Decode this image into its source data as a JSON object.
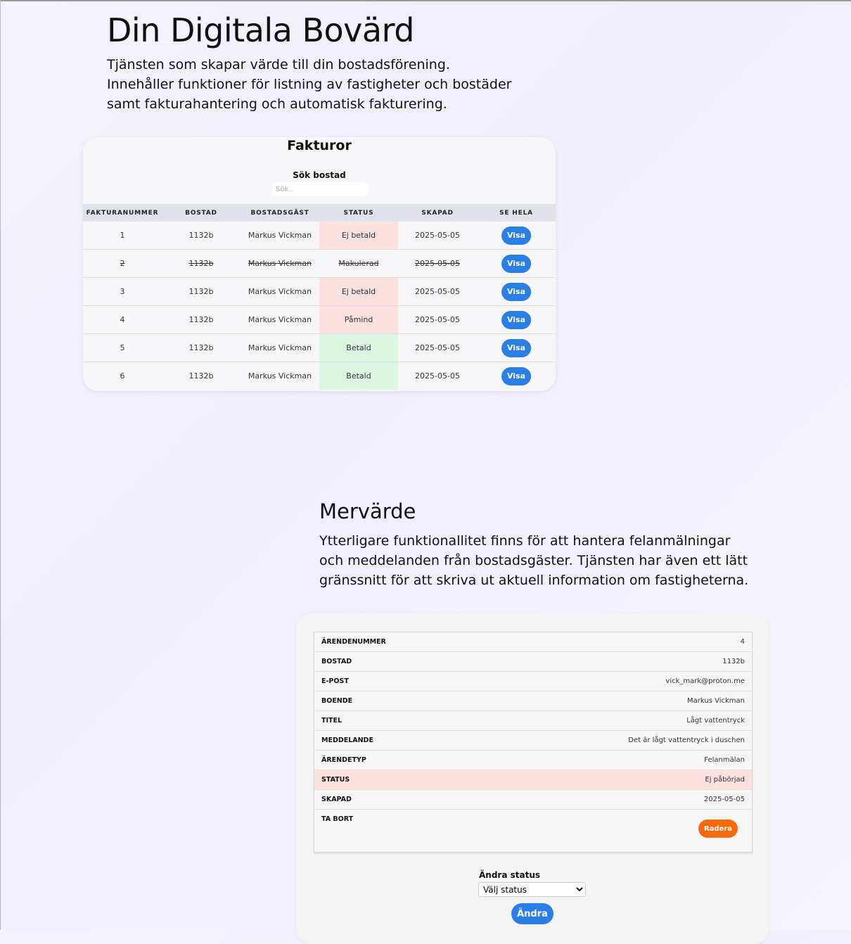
{
  "hero": {
    "title": "Din Digitala Bovärd",
    "text": "Tjänsten som skapar värde till din bostadsförening. Innehåller funktioner för listning av fastigheter och bostäder samt fakturahantering och automatisk fakturering."
  },
  "invoices": {
    "title": "Fakturor",
    "search_label": "Sök bostad",
    "search_placeholder": "Sök..",
    "columns": [
      "FAKTURANUMMER",
      "BOSTAD",
      "BOSTADSGÄST",
      "STATUS",
      "SKAPAD",
      "SE HELA"
    ],
    "rows": [
      {
        "number": "1",
        "unit": "1132b",
        "guest": "Markus Vickman",
        "status": "Ej betald",
        "created": "2025-05-05",
        "action": "Visa",
        "tone": "red",
        "void": false
      },
      {
        "number": "2",
        "unit": "1132b",
        "guest": "Markus Vickman",
        "status": "Makulerad",
        "created": "2025-05-05",
        "action": "Visa",
        "tone": "none",
        "void": true
      },
      {
        "number": "3",
        "unit": "1132b",
        "guest": "Markus Vickman",
        "status": "Ej betald",
        "created": "2025-05-05",
        "action": "Visa",
        "tone": "red",
        "void": false
      },
      {
        "number": "4",
        "unit": "1132b",
        "guest": "Markus Vickman",
        "status": "Påmind",
        "created": "2025-05-05",
        "action": "Visa",
        "tone": "red",
        "void": false
      },
      {
        "number": "5",
        "unit": "1132b",
        "guest": "Markus Vickman",
        "status": "Betald",
        "created": "2025-05-05",
        "action": "Visa",
        "tone": "green",
        "void": false
      },
      {
        "number": "6",
        "unit": "1132b",
        "guest": "Markus Vickman",
        "status": "Betald",
        "created": "2025-05-05",
        "action": "Visa",
        "tone": "green",
        "void": false
      }
    ]
  },
  "extra": {
    "title": "Mervärde",
    "text": "Ytterligare funktionallitet finns för att hantera felanmälningar och meddelanden från bostadsgäster. Tjänsten har även ett lätt gränssnitt för att skriva ut aktuell information om fastigheterna."
  },
  "ticket": {
    "rows": [
      {
        "label": "ÄRENDENUMMER",
        "value": "4"
      },
      {
        "label": "BOSTAD",
        "value": "1132b"
      },
      {
        "label": "E-POST",
        "value": "vick_mark@proton.me"
      },
      {
        "label": "BOENDE",
        "value": "Markus Vickman"
      },
      {
        "label": "TITEL",
        "value": "Lågt vattentryck"
      },
      {
        "label": "MEDDELANDE",
        "value": "Det är lågt vattentryck i duschen"
      },
      {
        "label": "ÄRENDETYP",
        "value": "Felanmälan"
      },
      {
        "label": "STATUS",
        "value": "Ej påbörjad"
      },
      {
        "label": "SKAPAD",
        "value": "2025-05-05"
      }
    ],
    "delete_label": "TA BORT",
    "delete_button": "Radera",
    "change_status_label": "Ändra status",
    "status_select_value": "Välj status",
    "change_button": "Ändra"
  },
  "colors": {
    "accent_blue": "#2a7fe6",
    "delete_orange": "#fb6a0a",
    "status_red_bg": "#fde0e0",
    "status_green_bg": "#dcf8e4"
  }
}
